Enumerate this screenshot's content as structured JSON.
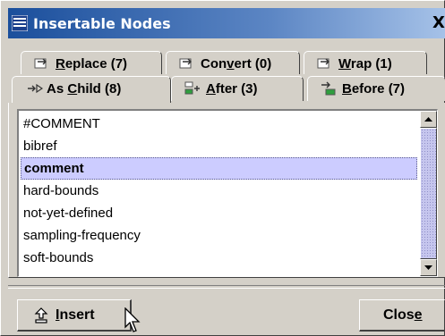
{
  "window": {
    "title": "Insertable Nodes",
    "close_glyph": "X"
  },
  "tabs_back_row": [
    {
      "prefix": "",
      "mnemonic": "R",
      "rest": "eplace (7)",
      "icon": "node-arrow-icon"
    },
    {
      "prefix": "Con",
      "mnemonic": "v",
      "rest": "ert (0)",
      "icon": "node-arrow-icon"
    },
    {
      "prefix": "",
      "mnemonic": "W",
      "rest": "rap (1)",
      "icon": "node-arrow-icon"
    }
  ],
  "tabs_front_row": [
    {
      "prefix": "As ",
      "mnemonic": "C",
      "rest": "hild (8)",
      "icon": "child-arrow-icon",
      "active": true
    },
    {
      "prefix": "",
      "mnemonic": "A",
      "rest": "fter (3)",
      "icon": "after-icon"
    },
    {
      "prefix": "",
      "mnemonic": "B",
      "rest": "efore (7)",
      "icon": "before-icon"
    }
  ],
  "list": {
    "items": [
      "#COMMENT",
      "bibref",
      "comment",
      "hard-bounds",
      "not-yet-defined",
      "sampling-frequency",
      "soft-bounds"
    ],
    "selected_index": 2
  },
  "buttons": {
    "insert": {
      "mnemonic": "I",
      "rest": "nsert",
      "icon": "insert-icon"
    },
    "close": {
      "prefix": "Clos",
      "mnemonic": "e",
      "rest": ""
    }
  },
  "colors": {
    "title_gradient_start": "#1b4f9c",
    "title_gradient_end": "#a6c2e8",
    "selection": "#ccccff",
    "scroll_thumb": "#c6c6ee"
  }
}
